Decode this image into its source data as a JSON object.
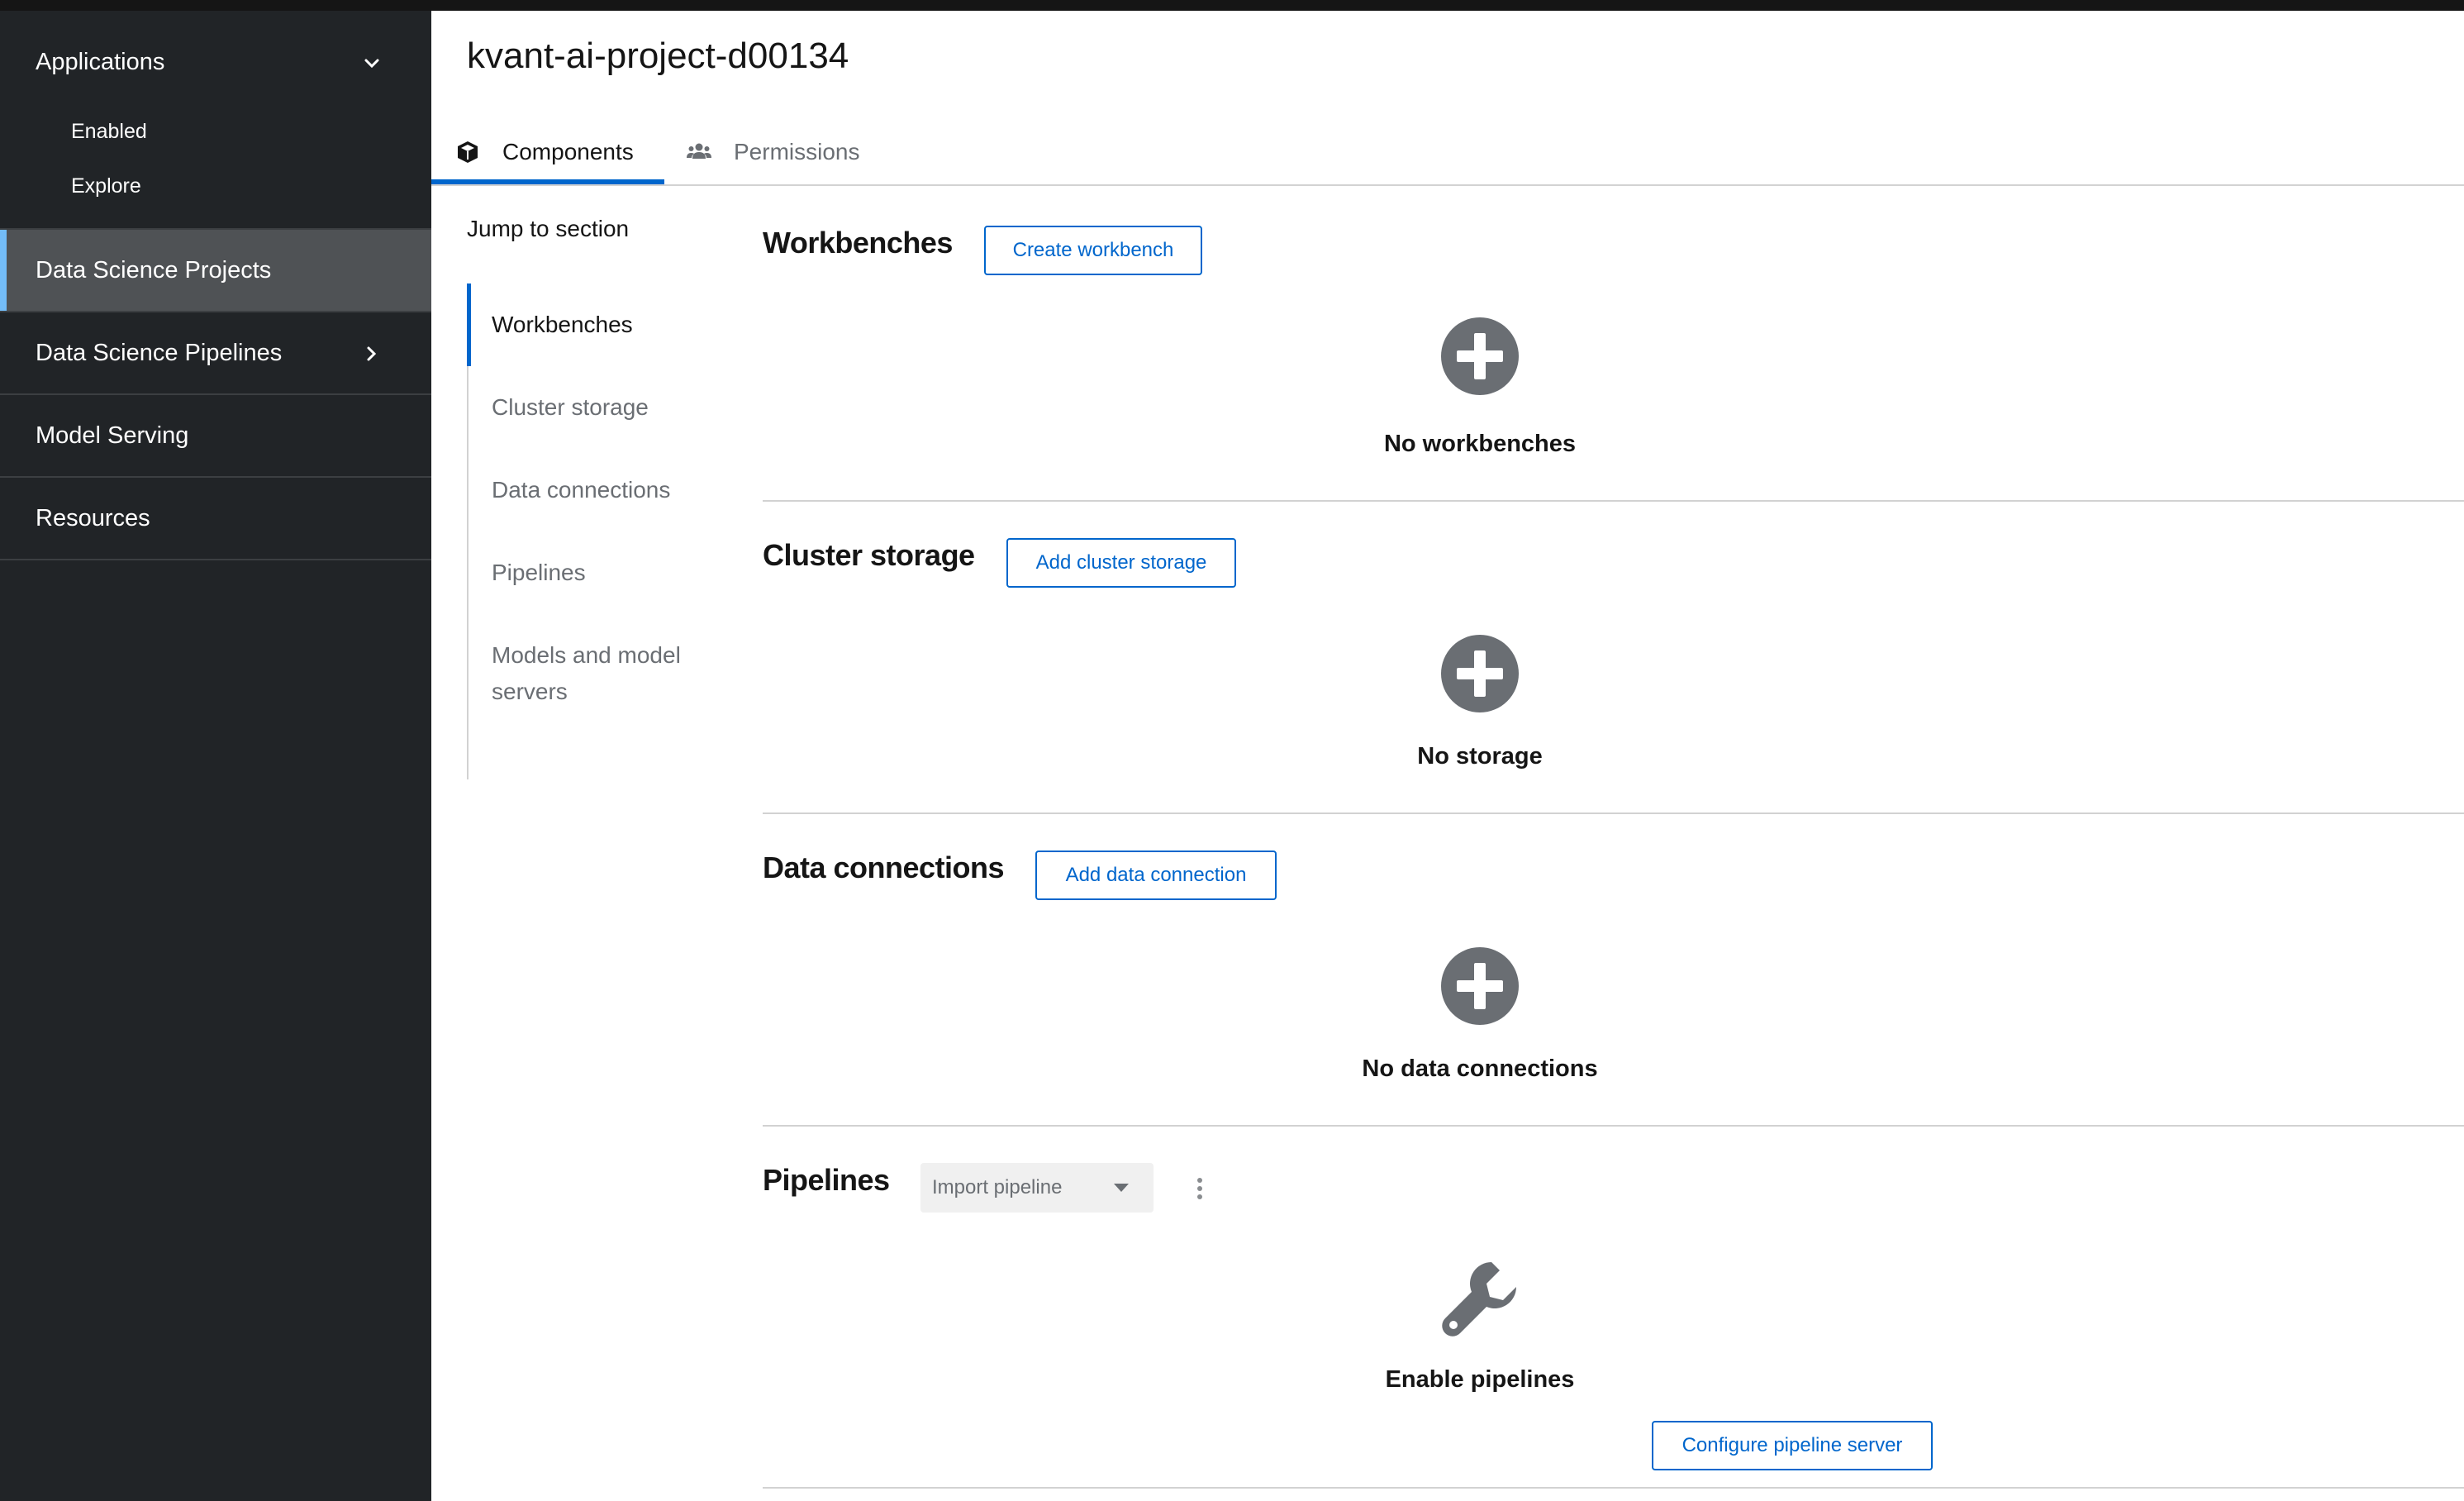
{
  "project_title": "kvant-ai-project-d00134",
  "sidebar": {
    "applications": {
      "label": "Applications",
      "items": [
        "Enabled",
        "Explore"
      ]
    },
    "items": [
      {
        "label": "Data Science Projects",
        "active": true
      },
      {
        "label": "Data Science Pipelines",
        "has_children": true
      },
      {
        "label": "Model Serving"
      },
      {
        "label": "Resources"
      }
    ]
  },
  "tabs": [
    {
      "label": "Components",
      "icon": "cube-icon",
      "active": true
    },
    {
      "label": "Permissions",
      "icon": "users-icon"
    }
  ],
  "jump": {
    "title": "Jump to section",
    "items": [
      "Workbenches",
      "Cluster storage",
      "Data connections",
      "Pipelines",
      "Models and model servers"
    ]
  },
  "sections": {
    "workbenches": {
      "title": "Workbenches",
      "button": "Create workbench",
      "empty_label": "No workbenches",
      "empty_icon": "plus-circle-icon"
    },
    "cluster_storage": {
      "title": "Cluster storage",
      "button": "Add cluster storage",
      "empty_label": "No storage",
      "empty_icon": "plus-circle-icon"
    },
    "data_connections": {
      "title": "Data connections",
      "button": "Add data connection",
      "empty_label": "No data connections",
      "empty_icon": "plus-circle-icon"
    },
    "pipelines": {
      "title": "Pipelines",
      "select_label": "Import pipeline",
      "empty_label": "Enable pipelines",
      "empty_icon": "wrench-icon",
      "button": "Configure pipeline server"
    }
  },
  "colors": {
    "sidebar_bg": "#212427",
    "accent": "#0066cc",
    "active_item_bg": "#4f5255",
    "active_indicator": "#73bcf7"
  }
}
